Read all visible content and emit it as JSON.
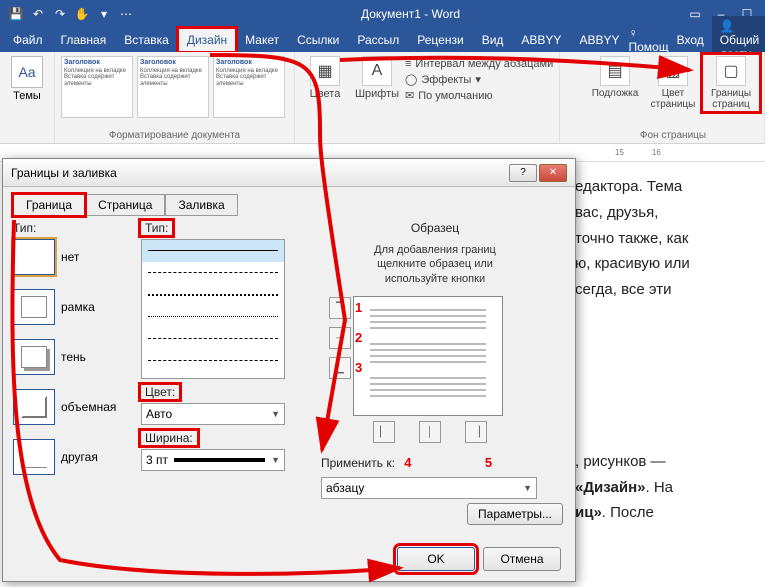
{
  "titlebar": {
    "title": "Документ1 - Word"
  },
  "tabs": {
    "file": "Файл",
    "home": "Главная",
    "insert": "Вставка",
    "design": "Дизайн",
    "layout": "Макет",
    "references": "Ссылки",
    "mailings": "Рассыл",
    "review": "Рецензи",
    "view": "Вид",
    "abbyy1": "ABBYY",
    "abbyy2": "ABBYY",
    "help": "Помощ",
    "signin_label": "Вход",
    "share": "Общий досту"
  },
  "ribbon": {
    "themes": "Темы",
    "styleset_heading": "Заголовок",
    "group_format": "Форматирование документа",
    "colors": "Цвета",
    "fonts": "Шрифты",
    "spacing": "Интервал между абзацами",
    "effects": "Эффекты",
    "default": "По умолчанию",
    "watermark": "Подложка",
    "pagecolor": "Цвет страницы",
    "borders": "Границы страниц",
    "group_bg": "Фон страницы"
  },
  "ruler": {
    "m15": "15",
    "m16": "16"
  },
  "document": {
    "l1": "едактора. Тема",
    "l2": "вас, друзья,",
    "l3": "точно также, как",
    "l4": "ю, красивую или",
    "l5": "сегда, все эти",
    "l6": ", рисунков —",
    "l7a": "«Дизайн»",
    "l7b": ". На",
    "l8a": "иц»",
    "l8b": ". После"
  },
  "dialog": {
    "title": "Границы и заливка",
    "tabs": {
      "border": "Граница",
      "page": "Страница",
      "fill": "Заливка"
    },
    "labels": {
      "setting": "Тип:",
      "style": "Тип:",
      "color": "Цвет:",
      "width": "Ширина:",
      "preview": "Образец",
      "hint": "Для добавления границ щелкните образец или используйте кнопки",
      "apply": "Применить к:"
    },
    "settings": {
      "none": "нет",
      "box": "рамка",
      "shadow": "тень",
      "threed": "объемная",
      "custom": "другая"
    },
    "color_value": "Авто",
    "width_value": "3 пт",
    "apply_value": "абзацу",
    "params": "Параметры...",
    "ok": "OK",
    "cancel": "Отмена",
    "annot": {
      "n1": "1",
      "n2": "2",
      "n3": "3",
      "n4": "4",
      "n5": "5"
    }
  }
}
